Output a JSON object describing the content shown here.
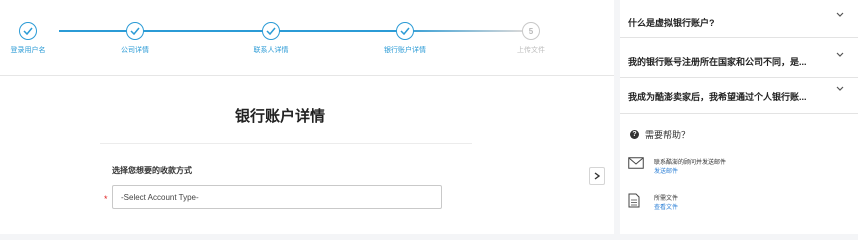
{
  "stepper": {
    "steps": [
      {
        "label": "登录用户名",
        "state": "done"
      },
      {
        "label": "公司详情",
        "state": "done"
      },
      {
        "label": "联系人详情",
        "state": "done"
      },
      {
        "label": "银行账户详情",
        "state": "current"
      },
      {
        "label": "上传文件",
        "state": "pending",
        "number": "5"
      }
    ],
    "accent_color": "#2b9bd6"
  },
  "form": {
    "title": "银行账户详情",
    "section_label": "选择您想要的收款方式",
    "required_mark": "*",
    "account_type_placeholder": "-Select Account Type-"
  },
  "faq": {
    "items": [
      {
        "question": "什么是虚拟银行账户?"
      },
      {
        "question": "我的银行账号注册所在国家和公司不同，是..."
      },
      {
        "question": "我成为酷澎卖家后，我希望通过个人银行账..."
      }
    ]
  },
  "help": {
    "title": "需要帮助？",
    "rows": [
      {
        "icon": "envelope-icon",
        "text": "联系酷澎的顾问并发送邮件",
        "link": "发送邮件"
      },
      {
        "icon": "document-icon",
        "text": "所需文件",
        "link": "查看文件"
      }
    ]
  }
}
